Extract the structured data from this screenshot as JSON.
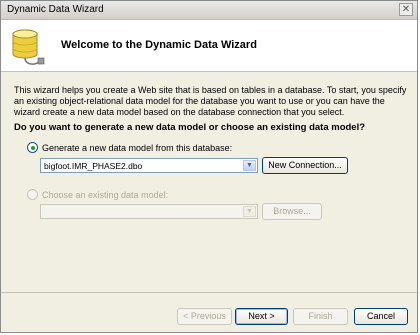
{
  "window": {
    "title": "Dynamic Data Wizard",
    "close_glyph": "✕"
  },
  "header": {
    "title": "Welcome to the Dynamic Data Wizard",
    "icon": "database-icon"
  },
  "description": "This wizard helps you create a Web site that is based on tables in a database.  To start, you specify an existing object-relational data model for the database you want to use or you can have the wizard create a new data model based on the database connection that you select.",
  "question": "Do you want to generate a new data model or choose an existing data model?",
  "option_new": {
    "label": "Generate a new data model from this database:",
    "selected": true,
    "connection_value": "bigfoot.IMR_PHASE2.dbo",
    "new_connection_label": "New Connection..."
  },
  "option_existing": {
    "label": "Choose an existing data model:",
    "selected": false,
    "model_value": "",
    "browse_label": "Browse..."
  },
  "footer": {
    "previous_label": "< Previous",
    "next_label": "Next >",
    "finish_label": "Finish",
    "cancel_label": "Cancel"
  }
}
